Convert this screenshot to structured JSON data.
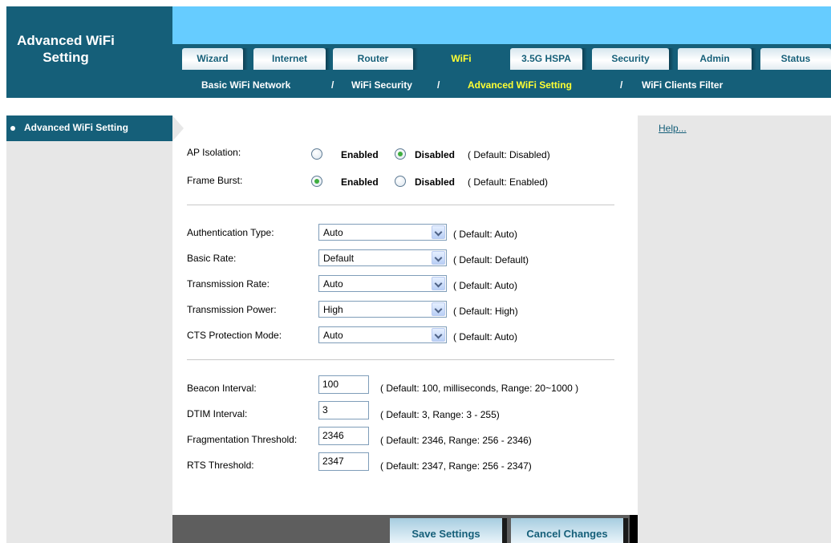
{
  "page": {
    "title": "Advanced WiFi Setting"
  },
  "tabs": [
    {
      "label": "Wizard"
    },
    {
      "label": "Internet"
    },
    {
      "label": "Router"
    },
    {
      "label": "WiFi"
    },
    {
      "label": "3.5G HSPA"
    },
    {
      "label": "Security"
    },
    {
      "label": "Admin"
    },
    {
      "label": "Status"
    }
  ],
  "subnav": [
    {
      "label": "Basic WiFi Network"
    },
    {
      "label": "WiFi Security"
    },
    {
      "label": "Advanced WiFi Setting"
    },
    {
      "label": "WiFi Clients Filter"
    }
  ],
  "subnav_separator": "/",
  "sidebar": {
    "items": [
      {
        "label": "Advanced WiFi Setting"
      }
    ]
  },
  "help": {
    "label": "Help..."
  },
  "form": {
    "ap_isolation": {
      "label": "AP Isolation:",
      "enabled_label": "Enabled",
      "disabled_label": "Disabled",
      "hint": "( Default: Disabled)",
      "selected": "Disabled"
    },
    "frame_burst": {
      "label": "Frame Burst:",
      "enabled_label": "Enabled",
      "disabled_label": "Disabled",
      "hint": "( Default: Enabled)",
      "selected": "Enabled"
    },
    "authentication_type": {
      "label": "Authentication Type:",
      "value": "Auto",
      "hint": "( Default: Auto)"
    },
    "basic_rate": {
      "label": "Basic Rate:",
      "value": "Default",
      "hint": "( Default: Default)"
    },
    "transmission_rate": {
      "label": "Transmission Rate:",
      "value": "Auto",
      "hint": "( Default: Auto)"
    },
    "transmission_power": {
      "label": "Transmission Power:",
      "value": "High",
      "hint": "( Default: High)"
    },
    "cts_protection_mode": {
      "label": "CTS Protection Mode:",
      "value": "Auto",
      "hint": "( Default: Auto)"
    },
    "beacon_interval": {
      "label": "Beacon Interval:",
      "value": "100",
      "hint": "( Default: 100, milliseconds, Range: 20~1000 )"
    },
    "dtim_interval": {
      "label": "DTIM Interval:",
      "value": "3",
      "hint": "( Default: 3, Range: 3 - 255)"
    },
    "fragmentation_threshold": {
      "label": "Fragmentation Threshold:",
      "value": "2346",
      "hint": "( Default: 2346, Range: 256 - 2346)"
    },
    "rts_threshold": {
      "label": "RTS Threshold:",
      "value": "2347",
      "hint": "( Default: 2347, Range: 256 - 2347)"
    }
  },
  "footer": {
    "save_label": "Save Settings",
    "cancel_label": "Cancel Changes"
  },
  "colors": {
    "brand_dark": "#155f79",
    "header_light": "#66ccff",
    "active_text": "#ffff33",
    "panel_grey": "#e7e7e7"
  }
}
